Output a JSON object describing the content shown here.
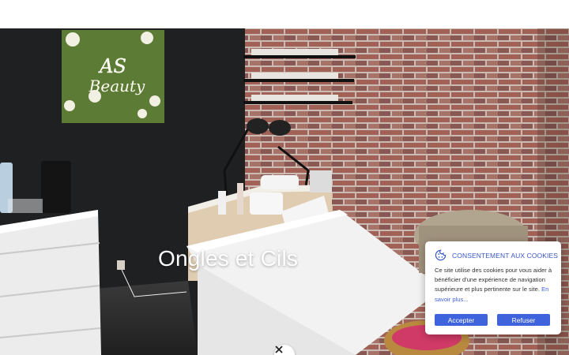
{
  "hero": {
    "title": "Ongles et Cils",
    "sign_text": "AS Beauty",
    "scroll_icon": "chevron-down-icon"
  },
  "cookie_banner": {
    "title": "CONSENTEMENT AUX COOKIES",
    "text": "Ce site utilise des cookies pour vous aider à bénéficier d'une expérience de navigation supérieure et plus pertinente sur le site.",
    "link_label": "En savoir plus...",
    "accept_label": "Accepter",
    "refuse_label": "Refuser",
    "icon": "cookie-icon",
    "accent_color": "#3e63dd"
  }
}
